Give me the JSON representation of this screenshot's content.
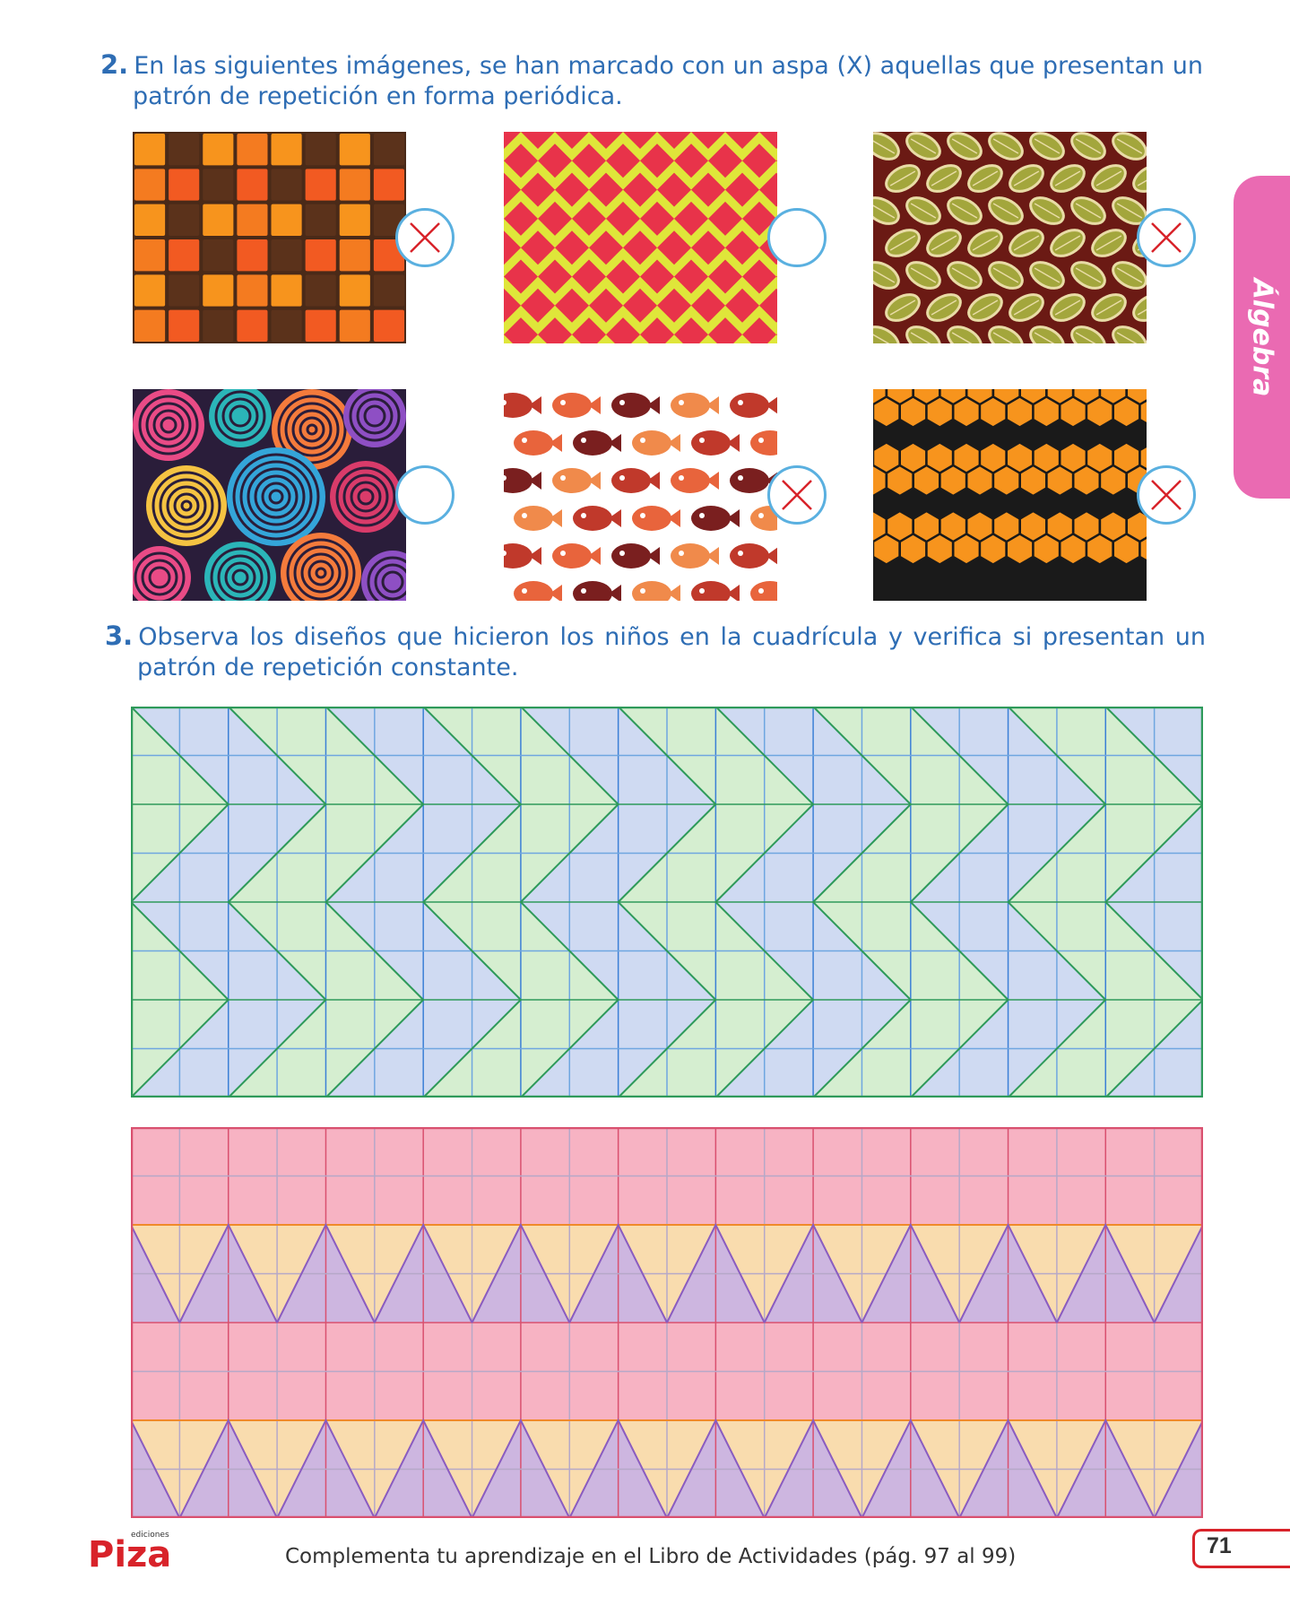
{
  "question2": {
    "number": "2.",
    "line1": "En las siguientes imágenes, se han marcado con un aspa (X) aquellas que presentan un",
    "line2": "patrón de repetición en forma periódica."
  },
  "images": [
    {
      "name": "brick-squares",
      "marked": true
    },
    {
      "name": "yellow-red-waves",
      "marked": false
    },
    {
      "name": "leaves",
      "marked": true
    },
    {
      "name": "swirls",
      "marked": false
    },
    {
      "name": "fish",
      "marked": true
    },
    {
      "name": "hexagons",
      "marked": true
    }
  ],
  "question3": {
    "number": "3.",
    "line1": "Observa los diseños que hicieron los niños en la cuadrícula y verifica si presentan un",
    "line2": "patrón de repetición constante."
  },
  "side_tab": {
    "label": "Álgebra"
  },
  "footer": {
    "logo_small": "ediciones",
    "logo": "Piza",
    "text": "Complementa tu aprendizaje en el Libro de Actividades (pág. 97 al 99)",
    "page_number": "71"
  },
  "colors": {
    "accent_blue": "#2e6db4",
    "tab_pink": "#ea6ab2",
    "mark_red": "#d8232a",
    "circle_blue": "#5ab0e0"
  }
}
